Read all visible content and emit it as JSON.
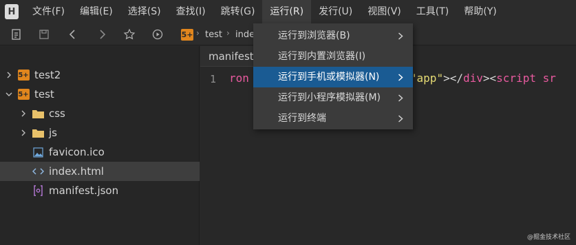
{
  "menubar": {
    "logo": "H",
    "items": [
      {
        "label": "文件(F)"
      },
      {
        "label": "编辑(E)"
      },
      {
        "label": "选择(S)"
      },
      {
        "label": "查找(I)"
      },
      {
        "label": "跳转(G)"
      },
      {
        "label": "运行(R)"
      },
      {
        "label": "发行(U)"
      },
      {
        "label": "视图(V)"
      },
      {
        "label": "工具(T)"
      },
      {
        "label": "帮助(Y)"
      }
    ]
  },
  "toolbar": {
    "icons": [
      "new-file-icon",
      "save-icon",
      "back-icon",
      "forward-icon",
      "star-icon",
      "run-icon"
    ],
    "breadcrumb": {
      "badge": "5+",
      "project": "test",
      "file_partial": "inde"
    }
  },
  "sidebar": {
    "tree": [
      {
        "label": "test2",
        "icon": "uniapp-project-icon",
        "badge": "5+",
        "expanded": false
      },
      {
        "label": "test",
        "icon": "uniapp-project-icon",
        "badge": "5+",
        "expanded": true
      },
      {
        "label": "css",
        "icon": "folder-icon",
        "expanded": false
      },
      {
        "label": "js",
        "icon": "folder-icon",
        "expanded": false
      },
      {
        "label": "favicon.ico",
        "icon": "image-file-icon"
      },
      {
        "label": "index.html",
        "icon": "html-file-icon",
        "selected": true
      },
      {
        "label": "manifest.json",
        "icon": "json-file-icon"
      }
    ]
  },
  "editor": {
    "tab_label": "manifest",
    "line_number": "1",
    "code": {
      "t1": "ron",
      "t2": "\"app\"",
      "t3": "></",
      "t4": "div",
      "t5": "><",
      "t6": "script",
      "t7": " sr"
    }
  },
  "run_menu": {
    "items": [
      {
        "label": "运行到浏览器(B)",
        "submenu": true
      },
      {
        "label": "运行到内置浏览器(I)",
        "submenu": false
      },
      {
        "label": "运行到手机或模拟器(N)",
        "submenu": true,
        "highlighted": true
      },
      {
        "label": "运行到小程序模拟器(M)",
        "submenu": true
      },
      {
        "label": "运行到终端",
        "submenu": true
      }
    ]
  },
  "watermark": "@掘金技术社区",
  "colors": {
    "accent": "#1a5b93",
    "badge": "#e1861d",
    "folder": "#e8c16a",
    "keyword": "#e85a9f",
    "string": "#e6db74"
  }
}
